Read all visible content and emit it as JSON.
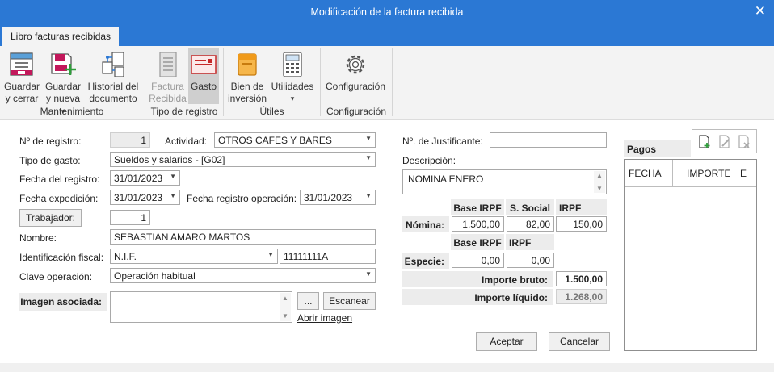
{
  "window": {
    "title": "Modificación de la factura recibida",
    "close_glyph": "✕"
  },
  "tab": {
    "label": "Libro facturas recibidas"
  },
  "ribbon": {
    "buttons": [
      {
        "line1": "Guardar",
        "line2": "y cerrar",
        "icon": "save-close-icon"
      },
      {
        "line1": "Guardar",
        "line2": "y nueva",
        "arrow": "▾",
        "icon": "save-new-icon"
      },
      {
        "line1": "Historial del",
        "line2": "documento",
        "icon": "history-icon"
      },
      {
        "line1": "Factura",
        "line2": "Recibida",
        "icon": "invoice-icon"
      },
      {
        "line1": "Gasto",
        "line2": "",
        "icon": "expense-icon"
      },
      {
        "line1": "Bien de",
        "line2": "inversión",
        "icon": "investment-icon"
      },
      {
        "line1": "Utilidades",
        "line2": "▾",
        "icon": "calculator-icon"
      },
      {
        "line1": "Configuración",
        "line2": "",
        "icon": "gear-icon"
      }
    ],
    "groups": [
      "Mantenimiento",
      "Tipo de registro",
      "Útiles",
      "Configuración"
    ]
  },
  "form": {
    "registro_label": "Nº de registro:",
    "registro_value": "1",
    "actividad_label": "Actividad:",
    "actividad_value": "OTROS CAFES Y BARES",
    "tipo_gasto_label": "Tipo de gasto:",
    "tipo_gasto_value": "Sueldos y salarios - [G02]",
    "fecha_registro_label": "Fecha del registro:",
    "fecha_registro_value": "31/01/2023",
    "fecha_expedicion_label": "Fecha expedición:",
    "fecha_expedicion_value": "31/01/2023",
    "fecha_operacion_label": "Fecha registro operación:",
    "fecha_operacion_value": "31/01/2023",
    "trabajador_button": "Trabajador:",
    "trabajador_value": "1",
    "nombre_label": "Nombre:",
    "nombre_value": "SEBASTIAN AMARO MARTOS",
    "identificacion_label": "Identificación fiscal:",
    "identificacion_tipo": "N.I.F.",
    "identificacion_value": "11111111A",
    "clave_label": "Clave operación:",
    "clave_value": "Operación habitual",
    "imagen_label": "Imagen asociada:",
    "imagen_dots_button": "...",
    "escanear_button": "Escanear",
    "abrir_imagen_link": "Abrir imagen",
    "justificante_label": "Nº. de Justificante:",
    "justificante_value": "",
    "descripcion_label": "Descripción:",
    "descripcion_value": "NOMINA ENERO"
  },
  "nomina": {
    "headers": [
      "Base IRPF",
      "S. Social",
      "IRPF"
    ],
    "row_label": "Nómina:",
    "values": [
      "1.500,00",
      "82,00",
      "150,00"
    ]
  },
  "especie": {
    "headers": [
      "Base IRPF",
      "IRPF"
    ],
    "row_label": "Especie:",
    "values": [
      "0,00",
      "0,00"
    ]
  },
  "totals": {
    "bruto_label": "Importe bruto:",
    "bruto_value": "1.500,00",
    "liquido_label": "Importe líquido:",
    "liquido_value": "1.268,00"
  },
  "pagos": {
    "title": "Pagos",
    "columns": [
      "FECHA",
      "IMPORTE",
      "E"
    ],
    "toolbar_icons": [
      "new-doc-icon",
      "edit-doc-icon",
      "delete-doc-icon"
    ]
  },
  "actions": {
    "aceptar": "Aceptar",
    "cancelar": "Cancelar"
  },
  "colors": {
    "titlebar": "#2b78d4",
    "ribbon": "#f3f3f3",
    "label_bg": "#ececec"
  }
}
